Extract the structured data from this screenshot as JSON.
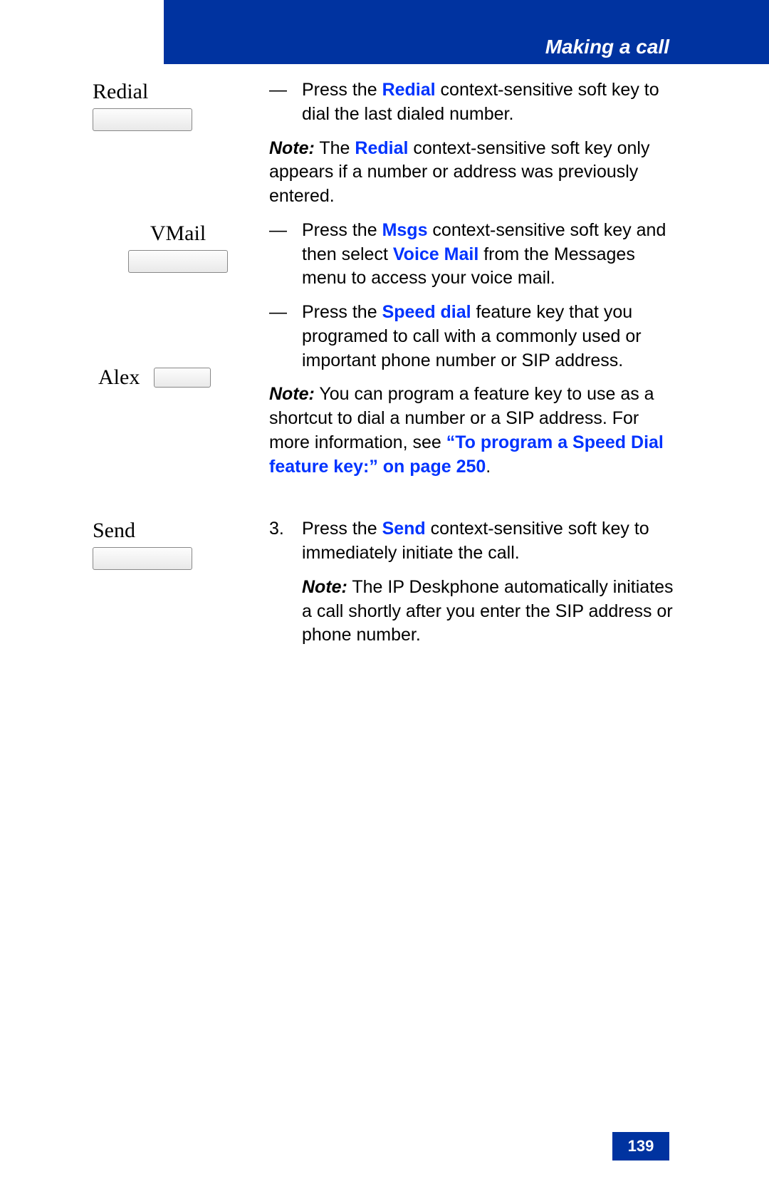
{
  "header": {
    "title": "Making a call"
  },
  "page_number": "139",
  "keys": {
    "redial": "Redial",
    "vmail": "VMail",
    "alex": "Alex",
    "send": "Send"
  },
  "body": {
    "redial_item": {
      "pre": "Press the ",
      "kw": "Redial",
      "post": " context-sensitive soft key to dial the last dialed number."
    },
    "redial_note": {
      "label": "Note:",
      "pre": "  The ",
      "kw": "Redial",
      "post": " context-sensitive soft key only appears if a number or address was previously entered."
    },
    "msgs_item": {
      "pre": "Press the ",
      "kw1": "Msgs",
      "mid": " context-sensitive soft key and then select ",
      "kw2": "Voice Mail",
      "post": " from the Messages menu to access your voice mail."
    },
    "speed_item": {
      "pre": "Press the ",
      "kw": "Speed dial",
      "post": " feature key that you programed to call with a commonly used or important phone number or SIP address."
    },
    "speed_note": {
      "label": "Note:",
      "pre": "  You can program a feature key to use as a shortcut to dial a number or a SIP address. For more information, see ",
      "link": "“To program a Speed Dial feature key:” on page 250",
      "post": "."
    },
    "step3": {
      "marker": "3.",
      "pre": "Press the ",
      "kw": "Send",
      "post": " context-sensitive soft key to immediately initiate the call."
    },
    "step3_note": {
      "label": "Note:",
      "text": "  The IP Deskphone automatically initiates a call shortly after you enter the SIP address or phone number."
    }
  }
}
